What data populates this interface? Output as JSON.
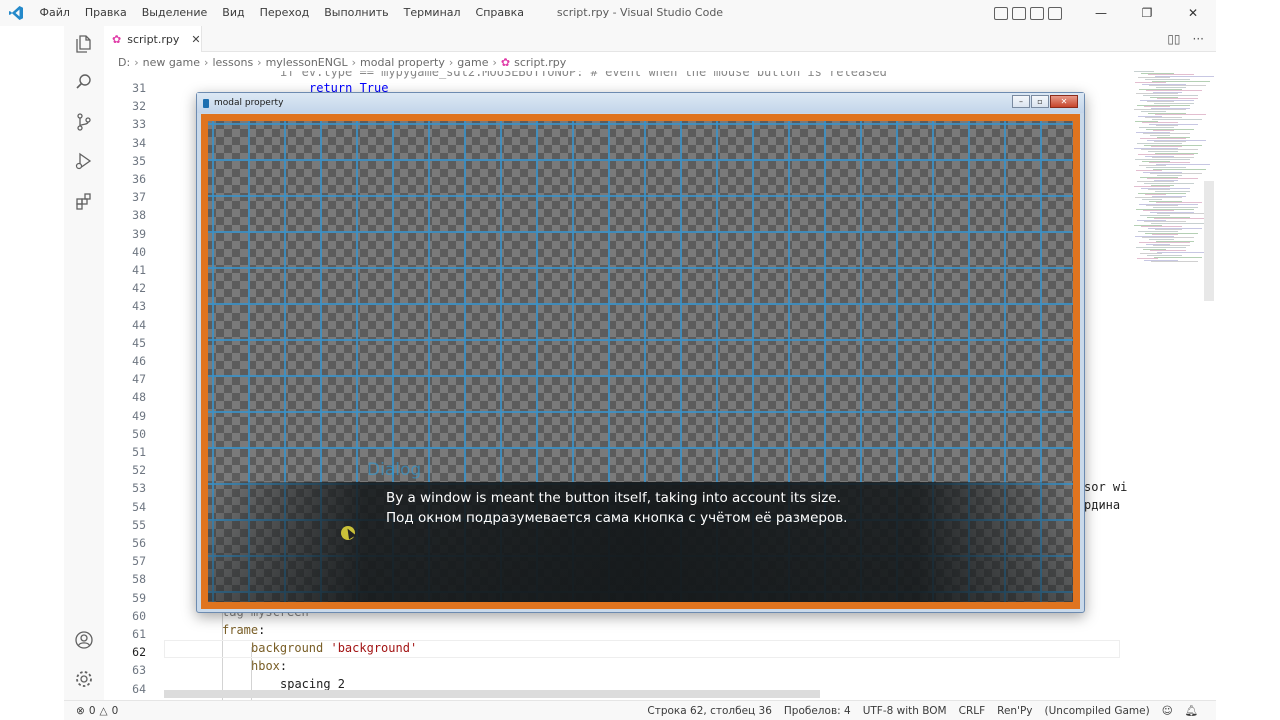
{
  "titlebar": {
    "menu": [
      "Файл",
      "Правка",
      "Выделение",
      "Вид",
      "Переход",
      "Выполнить",
      "Терминал",
      "Справка"
    ],
    "title": "script.rpy - Visual Studio Code",
    "window_buttons": [
      "—",
      "❐",
      "✕"
    ]
  },
  "tab": {
    "label": "script.rpy",
    "close": "✕",
    "split": "▯▯",
    "more": "···"
  },
  "breadcrumb": [
    "D:",
    "new game",
    "lessons",
    "mylessonENGL",
    "modal property",
    "game",
    "script.rpy"
  ],
  "editor": {
    "line_numbers": [
      "31",
      "32",
      "33",
      "34",
      "35",
      "36",
      "37",
      "38",
      "39",
      "40",
      "41",
      "42",
      "43",
      "44",
      "45",
      "46",
      "47",
      "48",
      "49",
      "50",
      "51",
      "52",
      "53",
      "54",
      "55",
      "56",
      "57",
      "58",
      "59",
      "60",
      "61",
      "62",
      "63",
      "64"
    ],
    "active_line": "62",
    "top_partial": "if ev.type == mypygame_sdl2.MOUSEBUTTONUP: # event when the mouse button is released",
    "line31": "return True",
    "line60": "tag myscreen",
    "line61_kw": "frame",
    "line61_rest": ":",
    "line62_kw": "background",
    "line62_str": "'background'",
    "line63_kw": "hbox",
    "line63_rest": ":",
    "line64": "spacing 2",
    "right_frag1": "sor wi",
    "right_frag2": "рдина"
  },
  "modal": {
    "title": "modal property",
    "speaker": "Dialog",
    "subtitle_en": "By a window is meant the button itself, taking into account its size.",
    "subtitle_ru": "Под окном подразумевается сама кнопка с учётом её размеров."
  },
  "statusbar": {
    "errors": "0",
    "warnings": "0",
    "position": "Строка 62, столбец 36",
    "spaces": "Пробелов: 4",
    "encoding": "UTF-8 with BOM",
    "eol": "CRLF",
    "language": "Ren'Py",
    "project": "(Uncompiled Game)"
  },
  "colors": {
    "accent_blue": "#007acc",
    "game_border": "#e0741f",
    "grid_lines": "#3a92c8",
    "tab_icon": "#e03ca8"
  }
}
